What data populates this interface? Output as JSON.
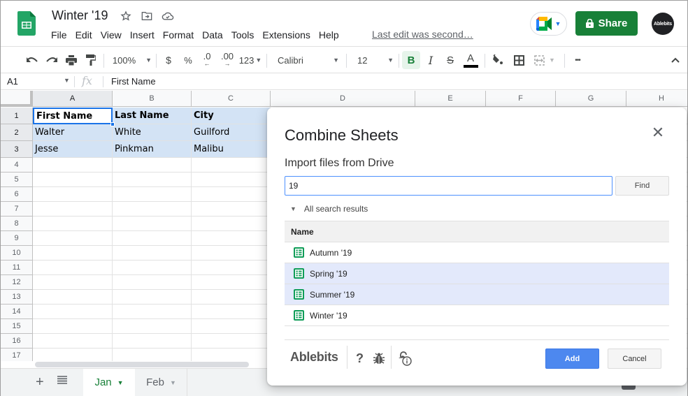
{
  "app": {
    "doc_title": "Winter '19",
    "menu": [
      "File",
      "Edit",
      "View",
      "Insert",
      "Format",
      "Data",
      "Tools",
      "Extensions",
      "Help"
    ],
    "last_edit": "Last edit was second…",
    "share_label": "Share",
    "avatar_text": "Ablebits",
    "colors": {
      "brand_green": "#188038",
      "selection_blue": "#1a73e8",
      "add_blue": "#4d88ef"
    }
  },
  "toolbar": {
    "zoom": "100%",
    "currency": "$",
    "percent": "%",
    "decrease_decimals": ".0",
    "increase_decimals": ".00",
    "more_formats": "123",
    "font": "Calibri",
    "font_size": "12",
    "bold": "B",
    "italic": "I",
    "strikethrough": "S",
    "text_color": "A",
    "more": "•••"
  },
  "formula_bar": {
    "name_box": "A1",
    "fx": "fx",
    "value": "First Name"
  },
  "grid": {
    "columns": [
      "A",
      "B",
      "C",
      "D",
      "E",
      "F",
      "G",
      "H"
    ],
    "rows": [
      "1",
      "2",
      "3",
      "4",
      "5",
      "6",
      "7",
      "8",
      "9",
      "10",
      "11",
      "12",
      "13",
      "14",
      "15",
      "16",
      "17"
    ],
    "cells": [
      [
        "First Name",
        "Last Name",
        "City"
      ],
      [
        "Walter",
        "White",
        "Guilford"
      ],
      [
        "Jesse",
        "Pinkman",
        "Malibu"
      ]
    ]
  },
  "sheets": {
    "tabs": [
      {
        "label": "Jan",
        "active": true
      },
      {
        "label": "Feb",
        "active": false
      }
    ]
  },
  "dialog": {
    "title": "Combine Sheets",
    "subtitle": "Import files from Drive",
    "search_value": "19",
    "find_label": "Find",
    "results_toggle": "All search results",
    "column_header": "Name",
    "results": [
      {
        "name": "Autumn '19",
        "selected": false
      },
      {
        "name": "Spring '19",
        "selected": true
      },
      {
        "name": "Summer '19",
        "selected": true
      },
      {
        "name": "Winter '19",
        "selected": false
      }
    ],
    "brand": "Ablebits",
    "help": "?",
    "add_label": "Add",
    "cancel_label": "Cancel"
  }
}
